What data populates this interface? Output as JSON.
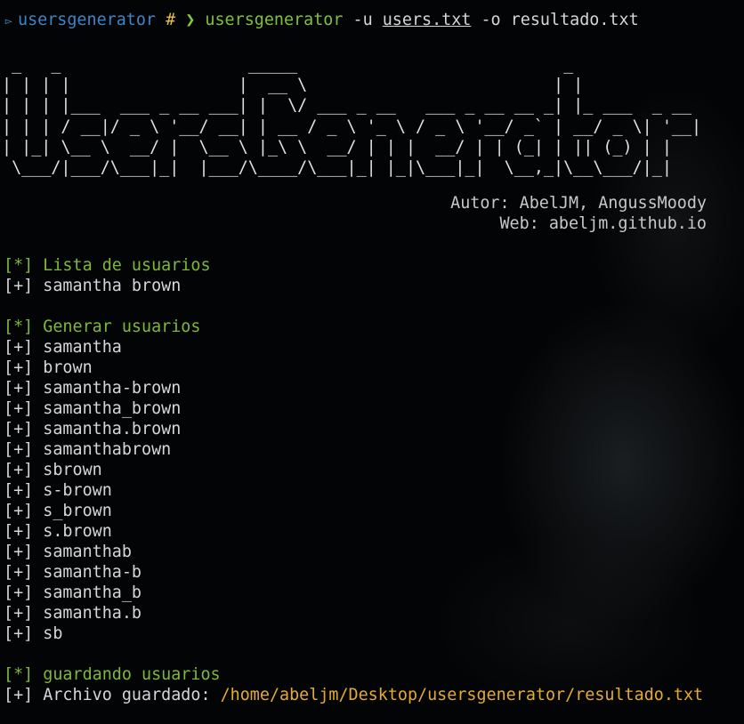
{
  "prompt": {
    "icon": "folder-icon",
    "directory": "usersgenerator",
    "hash": "#",
    "arrow": "❯",
    "command": "usersgenerator",
    "arg1": "-u",
    "file1": "users.txt",
    "arg2": "-o",
    "file2": "resultado.txt"
  },
  "banner": {
    "ascii": " _   _                   _____                           _             \n| | | |                 |  __ \\                         | |            \n| | | |___  ___ _ __ ___| |  \\/ ___ _ __   ___ _ __ __ _| |_ ___  _ __ \n| | | / __|/ _ \\ '__/ __| | __ / _ \\ '_ \\ / _ \\ '__/ _` | __/ _ \\| '__|\n| |_| \\__ \\  __/ |  \\__ \\ |_\\ \\  __/ | | |  __/ | | (_| | || (_) | |   \n \\___/|___/\\___|_|  |___/\\____/\\___|_| |_|\\___|_|  \\__,_|\\__\\___/|_|   ",
    "author": "Autor: AbelJM, AngussMoody",
    "web": "Web: abeljm.github.io"
  },
  "sections": {
    "list_header": "[*] Lista de usuarios",
    "list_items": [
      "[+] samantha brown"
    ],
    "generate_header": "[*] Generar usuarios",
    "generated": [
      "[+] samantha",
      "[+] brown",
      "[+] samantha-brown",
      "[+] samantha_brown",
      "[+] samantha.brown",
      "[+] samanthabrown",
      "[+] sbrown",
      "[+] s-brown",
      "[+] s_brown",
      "[+] s.brown",
      "[+] samanthab",
      "[+] samantha-b",
      "[+] samantha_b",
      "[+] samantha.b",
      "[+] sb"
    ],
    "save_header": "[*] guardando usuarios",
    "save_label": "[+] Archivo guardado: ",
    "save_path": "/home/abeljm/Desktop/usersgenerator/resultado.txt"
  },
  "colors": {
    "background": "#030405",
    "text": "#d6d6d6",
    "green": "#7eb83a",
    "yellow": "#e6ab2e",
    "path_blue": "#3d86c9"
  }
}
